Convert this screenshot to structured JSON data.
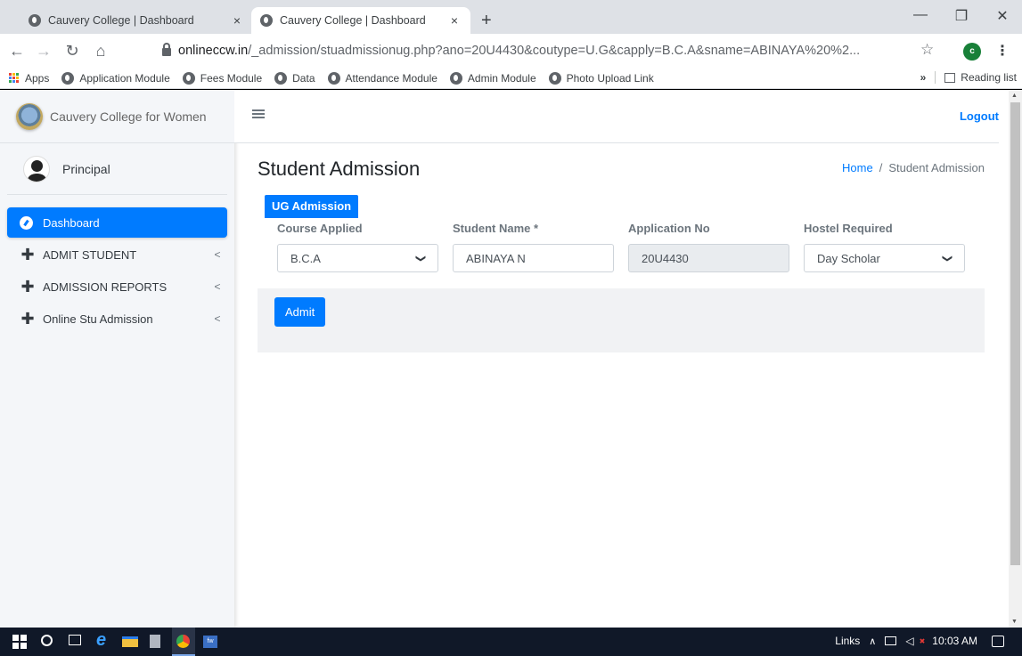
{
  "browser": {
    "tabs": [
      {
        "title": "Cauvery College | Dashboard",
        "close": "×"
      },
      {
        "title": "Cauvery College | Dashboard",
        "close": "×"
      }
    ],
    "new_tab": "+",
    "window_controls": {
      "minimize": "—",
      "maximize": "❐",
      "close": "✕"
    },
    "url_host": "onlineccw.in",
    "url_path": "/_admission/stuadmissionug.php?ano=20U4430&coutype=U.G&capply=B.C.A&sname=ABINAYA%20%2...",
    "profile_initial": "c",
    "bookmarks": [
      "Apps",
      "Application Module",
      "Fees Module",
      "Data",
      "Attendance Module",
      "Admin Module",
      "Photo Upload Link"
    ],
    "more_bookmarks": "»",
    "reading_list": "Reading list"
  },
  "sidebar": {
    "brand": "Cauvery College for Women",
    "user": "Principal",
    "items": [
      {
        "label": "Dashboard",
        "icon": "dashboard-icon",
        "active": true
      },
      {
        "label": "ADMIT STUDENT",
        "icon": "plus-icon",
        "caret": "<"
      },
      {
        "label": "ADMISSION REPORTS",
        "icon": "plus-icon",
        "caret": "<"
      },
      {
        "label": "Online Stu Admission",
        "icon": "plus-icon",
        "caret": "<"
      }
    ]
  },
  "header": {
    "logout": "Logout",
    "title": "Student Admission",
    "breadcrumb": {
      "home": "Home",
      "sep": "/",
      "current": "Student Admission"
    }
  },
  "form": {
    "tab": "UG Admission",
    "course": {
      "label": "Course Applied",
      "value": "B.C.A"
    },
    "student_name": {
      "label": "Student Name *",
      "value": "ABINAYA N"
    },
    "application_no": {
      "label": "Application No",
      "value": "20U4430"
    },
    "hostel": {
      "label": "Hostel Required",
      "value": "Day Scholar"
    },
    "submit": "Admit"
  },
  "taskbar": {
    "links": "Links",
    "time": "10:03 AM"
  },
  "colors": {
    "accent": "#007bff",
    "sidebar_bg": "#f4f6f9",
    "footer_bg": "#f1f2f4",
    "taskbar": "#101828"
  }
}
